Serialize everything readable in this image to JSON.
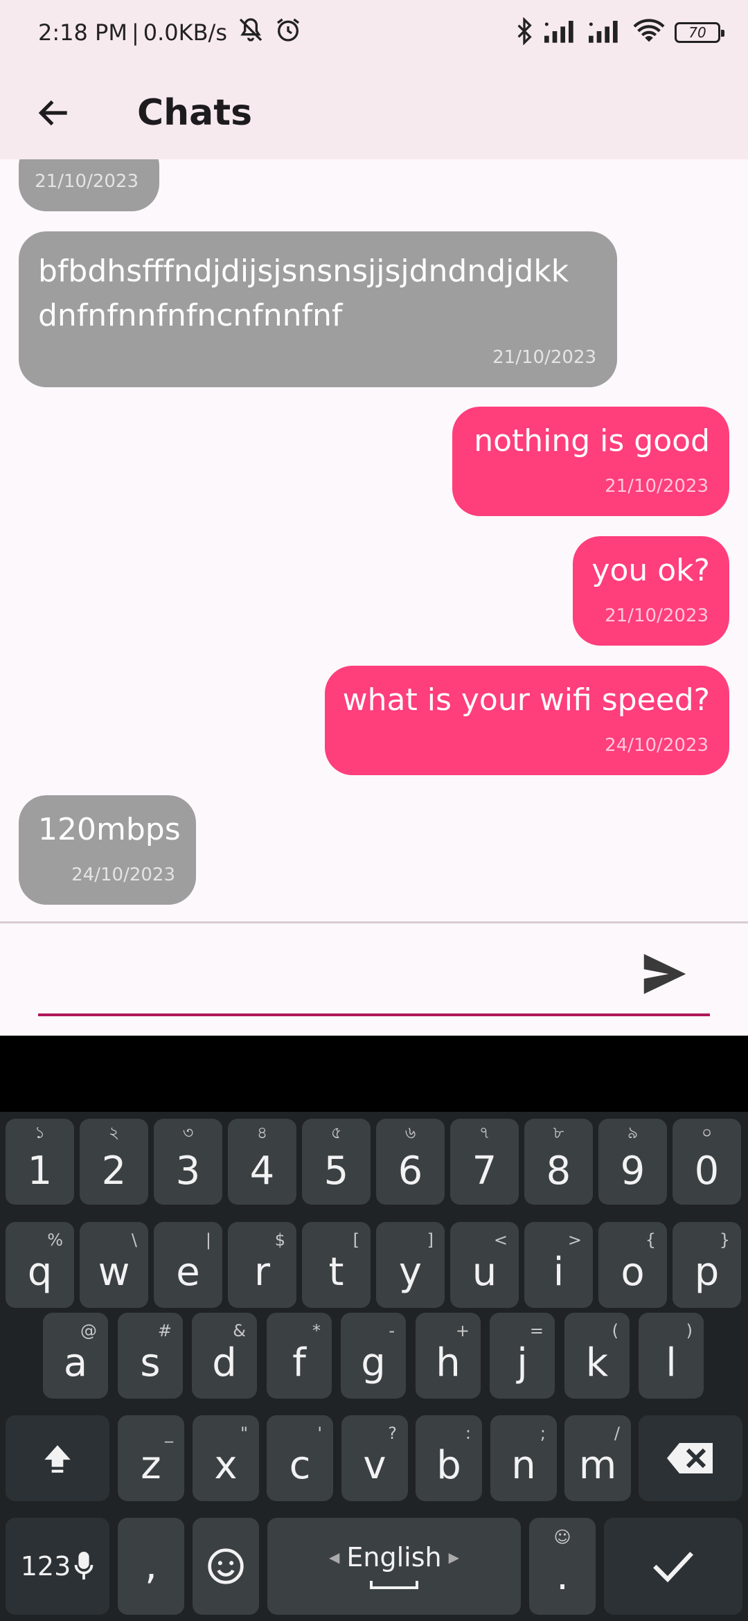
{
  "status_bar": {
    "time": "2:18 PM",
    "separator": "|",
    "speed": "0.0KB/s",
    "battery": "70",
    "icons": [
      "mute-icon",
      "alarm-icon",
      "bluetooth-icon",
      "signal-icon",
      "signal-icon",
      "wifi-icon",
      "battery-icon"
    ]
  },
  "app_bar": {
    "title": "Chats"
  },
  "messages": [
    {
      "text": "",
      "date": "21/10/2023",
      "side": "received"
    },
    {
      "text": "bfbdhsfffndjdijsjsnsnsjjsjdndndjdkk dnfnfnnfnfncnfnnfnf",
      "date": "21/10/2023",
      "side": "received"
    },
    {
      "text": "nothing is good",
      "date": "21/10/2023",
      "side": "sent"
    },
    {
      "text": "you ok?",
      "date": "21/10/2023",
      "side": "sent"
    },
    {
      "text": "what is your wifi speed?",
      "date": "24/10/2023",
      "side": "sent"
    },
    {
      "text": "120mbps",
      "date": "24/10/2023",
      "side": "received"
    }
  ],
  "composer": {
    "value": "",
    "placeholder": ""
  },
  "colors": {
    "received_bubble": "#9e9e9e",
    "sent_bubble": "#ff3e7c",
    "input_underline": "#b01859",
    "app_bar": "#f7eaef"
  },
  "keyboard": {
    "row1": [
      {
        "k": "1",
        "h": "১"
      },
      {
        "k": "2",
        "h": "২"
      },
      {
        "k": "3",
        "h": "৩"
      },
      {
        "k": "4",
        "h": "৪"
      },
      {
        "k": "5",
        "h": "৫"
      },
      {
        "k": "6",
        "h": "৬"
      },
      {
        "k": "7",
        "h": "৭"
      },
      {
        "k": "8",
        "h": "৮"
      },
      {
        "k": "9",
        "h": "৯"
      },
      {
        "k": "0",
        "h": "০"
      }
    ],
    "row2": [
      {
        "k": "q",
        "h": "%"
      },
      {
        "k": "w",
        "h": "\\"
      },
      {
        "k": "e",
        "h": "|"
      },
      {
        "k": "r",
        "h": "$"
      },
      {
        "k": "t",
        "h": "["
      },
      {
        "k": "y",
        "h": "]"
      },
      {
        "k": "u",
        "h": "<"
      },
      {
        "k": "i",
        "h": ">"
      },
      {
        "k": "o",
        "h": "{"
      },
      {
        "k": "p",
        "h": "}"
      }
    ],
    "row3": [
      {
        "k": "a",
        "h": "@"
      },
      {
        "k": "s",
        "h": "#"
      },
      {
        "k": "d",
        "h": "&"
      },
      {
        "k": "f",
        "h": "*"
      },
      {
        "k": "g",
        "h": "-"
      },
      {
        "k": "h",
        "h": "+"
      },
      {
        "k": "j",
        "h": "="
      },
      {
        "k": "k",
        "h": "("
      },
      {
        "k": "l",
        "h": ")"
      }
    ],
    "row4": [
      {
        "k": "z",
        "h": "_"
      },
      {
        "k": "x",
        "h": "\""
      },
      {
        "k": "c",
        "h": "'"
      },
      {
        "k": "v",
        "h": "?"
      },
      {
        "k": "b",
        "h": ":"
      },
      {
        "k": "n",
        "h": ";"
      },
      {
        "k": "m",
        "h": "/"
      }
    ],
    "num_key": "123",
    "comma": ",",
    "space_label": "English",
    "period": ".",
    "period_hint": "☺"
  }
}
